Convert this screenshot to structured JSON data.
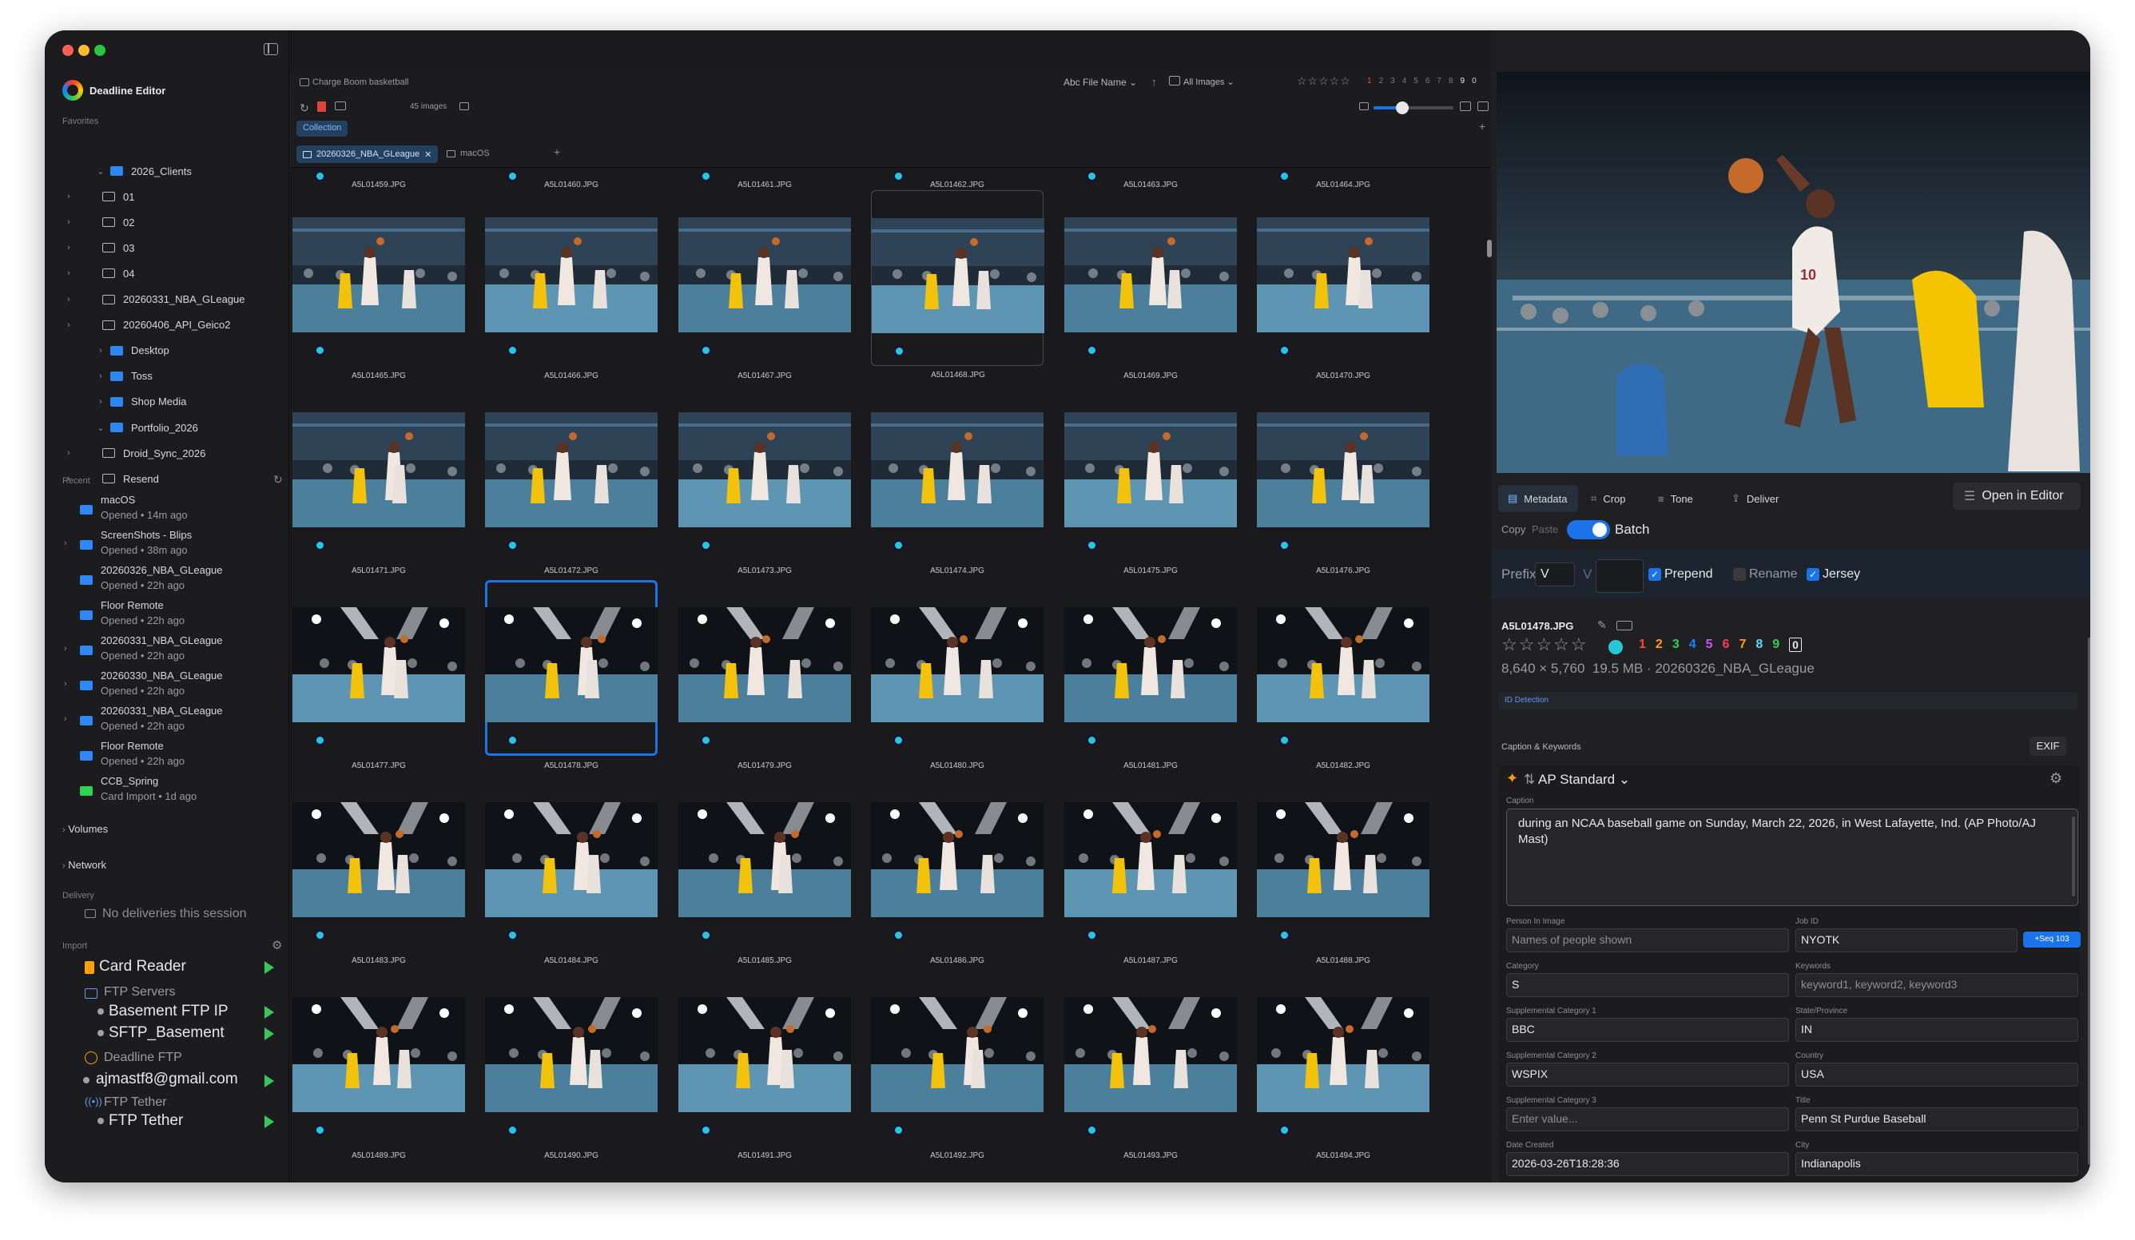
{
  "app": {
    "name": "Deadline Editor"
  },
  "sidebar": {
    "favorites_label": "Favorites",
    "tree": [
      {
        "label": "2026_Clients",
        "level": 0,
        "open": true,
        "blue": true
      },
      {
        "label": "01",
        "level": 1
      },
      {
        "label": "02",
        "level": 1
      },
      {
        "label": "03",
        "level": 1
      },
      {
        "label": "04",
        "level": 1
      },
      {
        "label": "20260331_NBA_GLeague",
        "level": 1
      },
      {
        "label": "20260406_API_Geico2",
        "level": 1
      },
      {
        "label": "Desktop",
        "level": 0,
        "blue": true
      },
      {
        "label": "Toss",
        "level": 0,
        "blue": true
      },
      {
        "label": "Shop Media",
        "level": 0,
        "blue": true
      },
      {
        "label": "Portfolio_2026",
        "level": 0,
        "open": true,
        "blue": true
      },
      {
        "label": "Droid_Sync_2026",
        "level": 1
      },
      {
        "label": "Resend",
        "level": 1
      }
    ],
    "recent_label": "Recent",
    "recent": [
      {
        "name": "macOS",
        "time": "Opened • 14m ago"
      },
      {
        "name": "ScreenShots - Blips",
        "time": "Opened • 38m ago",
        "chev": true
      },
      {
        "name": "20260326_NBA_GLeague",
        "time": "Opened • 22h ago"
      },
      {
        "name": "Floor Remote",
        "time": "Opened • 22h ago"
      },
      {
        "name": "20260331_NBA_GLeague",
        "time": "Opened • 22h ago",
        "chev": true
      },
      {
        "name": "20260330_NBA_GLeague",
        "time": "Opened • 22h ago",
        "chev": true
      },
      {
        "name": "20260331_NBA_GLeague",
        "time": "Opened • 22h ago",
        "chev": true
      },
      {
        "name": "Floor Remote",
        "time": "Opened • 22h ago"
      },
      {
        "name": "CCB_Spring",
        "time": "Card Import • 1d ago",
        "green": true
      }
    ],
    "volumes_label": "Volumes",
    "network_label": "Network",
    "delivery_label": "Delivery",
    "no_deliveries": "No deliveries this session",
    "import_label": "Import",
    "card_reader": "Card Reader",
    "ftp_servers": "FTP Servers",
    "basement_ftp": "Basement FTP IP",
    "sftp_basement": "SFTP_Basement",
    "deadline_ftp": "Deadline FTP",
    "email": "ajmastf8@gmail.com",
    "ftp_tether_group": "FTP Tether",
    "ftp_tether": "FTP Tether"
  },
  "toolbar": {
    "breadcrumb": "Charge Boom basketball",
    "sort_prefix": "Abc",
    "sort": "File Name",
    "filter": "All Images",
    "image_count": "45 images",
    "color_nums": [
      "1",
      "2",
      "3",
      "4",
      "5",
      "6",
      "7",
      "8",
      "9",
      "0"
    ],
    "collection": "Collection",
    "tab1": "20260326_NBA_GLeague",
    "tab2": "macOS"
  },
  "grid": {
    "top_row": [
      "A5L01459.JPG",
      "A5L01460.JPG",
      "A5L01461.JPG",
      "A5L01462.JPG",
      "A5L01463.JPG",
      "A5L01464.JPG"
    ],
    "rows": [
      [
        "A5L01465.JPG",
        "A5L01466.JPG",
        "A5L01467.JPG",
        "A5L01468.JPG",
        "A5L01469.JPG",
        "A5L01470.JPG"
      ],
      [
        "A5L01471.JPG",
        "A5L01472.JPG",
        "A5L01473.JPG",
        "A5L01474.JPG",
        "A5L01475.JPG",
        "A5L01476.JPG"
      ],
      [
        "A5L01477.JPG",
        "A5L01478.JPG",
        "A5L01479.JPG",
        "A5L01480.JPG",
        "A5L01481.JPG",
        "A5L01482.JPG"
      ],
      [
        "A5L01483.JPG",
        "A5L01484.JPG",
        "A5L01485.JPG",
        "A5L01486.JPG",
        "A5L01487.JPG",
        "A5L01488.JPG"
      ],
      [
        "A5L01489.JPG",
        "A5L01490.JPG",
        "A5L01491.JPG",
        "A5L01492.JPG",
        "A5L01493.JPG",
        "A5L01494.JPG"
      ]
    ],
    "selected": "A5L01478.JPG"
  },
  "inspector": {
    "tabs": [
      "Metadata",
      "Crop",
      "Tone",
      "Deliver"
    ],
    "open_in_editor": "Open in Editor",
    "copy": "Copy",
    "paste": "Paste",
    "batch": "Batch",
    "prefix_label": "Prefix",
    "prefix_value": "V",
    "prefix_v": "V",
    "prepend": "Prepend",
    "rename": "Rename",
    "jersey": "Jersey",
    "filename": "A5L01478.JPG",
    "dims": "8,640 × 5,760",
    "size": "19.5 MB",
    "folder": "20260326_NBA_GLeague",
    "id_detection": "ID Detection",
    "caption_keywords": "Caption & Keywords",
    "exif": "EXIF",
    "template": "AP Standard",
    "caption_label": "Caption",
    "caption": "during an NCAA baseball game on Sunday, March 22, 2026, in West Lafayette, Ind. (AP Photo/AJ Mast)",
    "fields": {
      "person_label": "Person In Image",
      "person_ph": "Names of people shown",
      "jobid_label": "Job ID",
      "jobid": "NYOTK",
      "seq": "+Seq 103",
      "category_label": "Category",
      "category": "S",
      "keywords_label": "Keywords",
      "keywords_ph": "keyword1, keyword2, keyword3",
      "supp1_label": "Supplemental Category 1",
      "supp1": "BBC",
      "state_label": "State/Province",
      "state": "IN",
      "supp2_label": "Supplemental Category 2",
      "supp2": "WSPIX",
      "country_label": "Country",
      "country": "USA",
      "supp3_label": "Supplemental Category 3",
      "supp3_ph": "Enter value...",
      "title_label": "Title",
      "title": "Penn St Purdue Baseball",
      "date_label": "Date Created",
      "date": "2026-03-26T18:28:36",
      "city_label": "City",
      "city": "Indianapolis"
    }
  },
  "colors": {
    "accent": "#1a73e8",
    "play": "#35c759",
    "badge": "#28c7d6",
    "labels": [
      "#ff453a",
      "#ff9f0a",
      "#30d158",
      "#0a84ff",
      "#bf5af2",
      "#ff375f",
      "#ff9f0a",
      "#64d2ff",
      "#30d158",
      "#e8e8ea"
    ]
  }
}
